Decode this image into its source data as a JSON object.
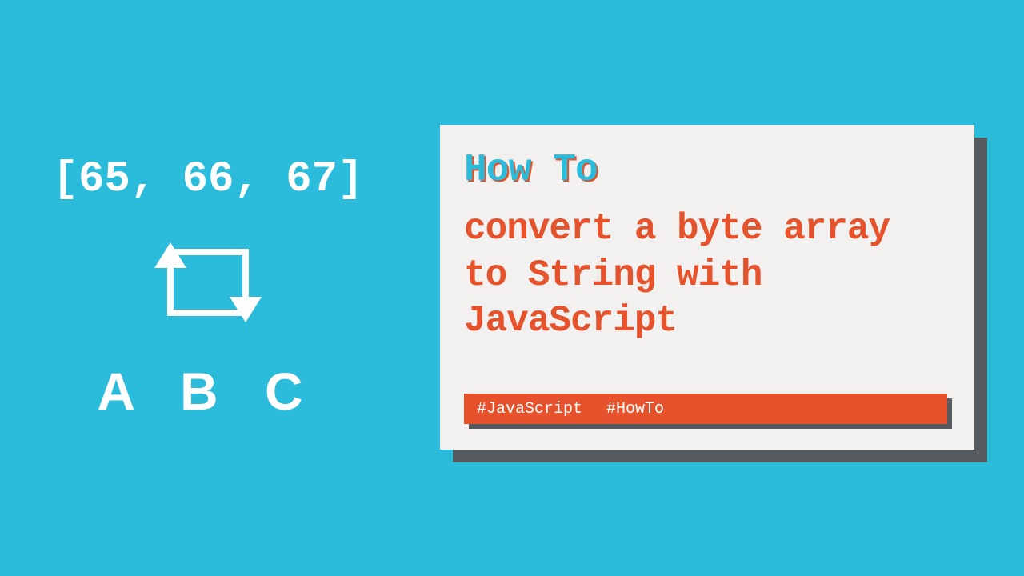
{
  "left": {
    "byte_array": "[65, 66, 67]",
    "result": "A B C"
  },
  "card": {
    "category": "How To",
    "title": "convert a byte array to String with JavaScript",
    "tags": [
      "#JavaScript",
      "#HowTo"
    ]
  },
  "colors": {
    "background": "#2bbcdb",
    "accent": "#e6522b",
    "card_bg": "#f2f1ef",
    "shadow": "#555b5e",
    "white": "#ffffff"
  }
}
